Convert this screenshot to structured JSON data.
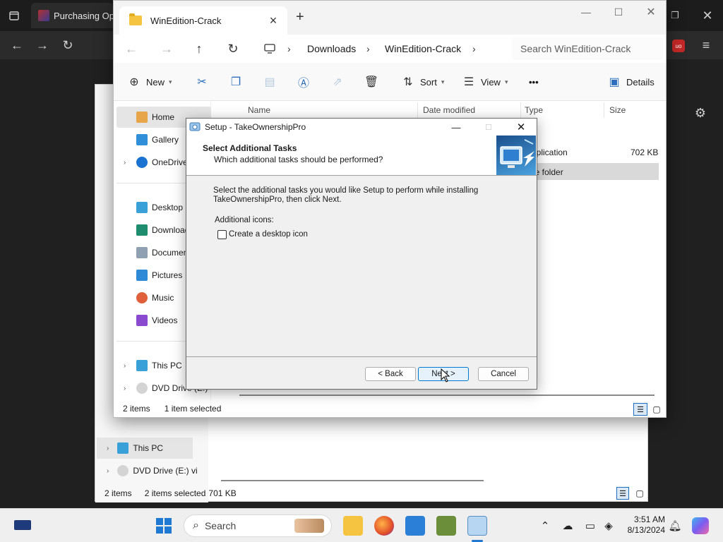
{
  "browser": {
    "tab_title": "Purchasing Opt"
  },
  "explorer": {
    "tab_title": "WinEdition-Crack",
    "breadcrumbs": [
      "Downloads",
      "WinEdition-Crack"
    ],
    "search_placeholder": "Search WinEdition-Crack",
    "commands": {
      "new": "New",
      "sort": "Sort",
      "view": "View",
      "more": "•••",
      "details": "Details"
    },
    "nav": {
      "home": "Home",
      "gallery": "Gallery",
      "onedrive": "OneDrive",
      "desktop": "Desktop",
      "downloads": "Downloads",
      "documents": "Documents",
      "pictures": "Pictures",
      "music": "Music",
      "videos": "Videos",
      "this_pc": "This PC",
      "dvd": "DVD Drive (E:) v"
    },
    "columns": [
      "Name",
      "Date modified",
      "Type",
      "Size"
    ],
    "rows": [
      {
        "type": "Application",
        "size": "702 KB"
      },
      {
        "type": "File folder",
        "size": ""
      }
    ],
    "status": {
      "items": "2 items",
      "selected": "1 item selected"
    }
  },
  "back_explorer": {
    "nav_this_pc": "This PC",
    "nav_dvd": "DVD Drive (E:) vi",
    "status_items": "2 items",
    "status_selected": "2 items selected",
    "status_size": "701 KB"
  },
  "setup_dialog": {
    "title": "Setup - TakeOwnershipPro",
    "heading": "Select Additional Tasks",
    "subheading": "Which additional tasks should be performed?",
    "description": "Select the additional tasks you would like Setup to perform while installing TakeOwnershipPro, then click Next.",
    "group_label": "Additional icons:",
    "checkbox_label": "Create a desktop icon",
    "checkbox_checked": false,
    "back_label": "< Back",
    "next_label": "Next >",
    "cancel_label": "Cancel"
  },
  "taskbar": {
    "search_placeholder": "Search",
    "time": "3:51 AM",
    "date": "8/13/2024"
  }
}
